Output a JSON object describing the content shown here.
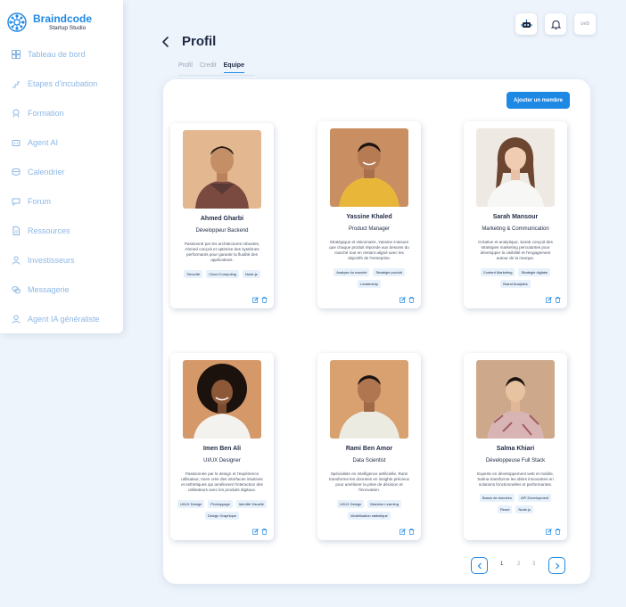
{
  "brand": {
    "name": "Braindcode",
    "subtitle": "Startup Studio"
  },
  "sidebar": {
    "items": [
      {
        "label": "Tableau de bord",
        "icon": "dashboard-icon"
      },
      {
        "label": "Etapes d'incubation",
        "icon": "steps-icon"
      },
      {
        "label": "Formation",
        "icon": "formation-icon"
      },
      {
        "label": "Agent AI",
        "icon": "robot-icon"
      },
      {
        "label": "Calendrier",
        "icon": "calendar-icon"
      },
      {
        "label": "Forum",
        "icon": "forum-icon"
      },
      {
        "label": "Ressources",
        "icon": "document-icon"
      },
      {
        "label": "Investisseurs",
        "icon": "investors-icon"
      },
      {
        "label": "Messagerie",
        "icon": "chat-icon"
      },
      {
        "label": "Agent IA généraliste",
        "icon": "user-ai-icon"
      }
    ]
  },
  "topbar": {
    "third_label": "ueb"
  },
  "header": {
    "title": "Profil"
  },
  "tabs": [
    {
      "label": "Profil",
      "active": false
    },
    {
      "label": "Credit",
      "active": false
    },
    {
      "label": "Equipe",
      "active": true
    }
  ],
  "actions": {
    "add_member": "Ajouter un membre"
  },
  "members": [
    {
      "name": "Ahmed Gharbi",
      "role": "Développeur Backend",
      "bio": "Passionné par les architectures robustes, Ahmed conçoit et optimise des systèmes performants pour garantir la fluidité des applications.",
      "tags": [
        "Sécurité",
        "Cloud Computing",
        "Node.js"
      ]
    },
    {
      "name": "Yassine Khaled",
      "role": "Product Manager",
      "bio": "Stratégique et visionnaire, Yassine s'assure que chaque produit réponde aux besoins du marché tout en restant aligné avec les objectifs de l'entreprise.",
      "tags": [
        "Analyse du marché",
        "Stratégie produit",
        "Leadership"
      ]
    },
    {
      "name": "Sarah Mansour",
      "role": "Marketing & Communication",
      "bio": "Créative et analytique, Sarah conçoit des stratégies marketing percutantes pour développer la visibilité et l'engagement autour de la marque.",
      "tags": [
        "Content Marketing",
        "Stratégie digitale",
        "Brand Analytics"
      ]
    },
    {
      "name": "Imen Ben Ali",
      "role": "UI/UX Designer",
      "bio": "Passionnée par le design et l'expérience utilisateur, Imen crée des interfaces intuitives et esthétiques qui améliorent l'interaction des utilisateurs avec les produits digitaux.",
      "tags": [
        "UI/UX Design",
        "Prototypage",
        "Identité Visuelle",
        "Design Graphique"
      ]
    },
    {
      "name": "Rami Ben Amor",
      "role": "Data Scientist",
      "bio": "Spécialiste en intelligence artificielle, Rami transforme les données en insights précieux pour améliorer la prise de décision et l'innovation.",
      "tags": [
        "UI/UX Design",
        "Machine Learning",
        "Modélisation statistique"
      ]
    },
    {
      "name": "Salma Khiari",
      "role": "Développeuse Full Stack",
      "bio": "Experte en développement web et mobile, Salma transforme les idées innovantes en solutions fonctionnelles et performantes.",
      "tags": [
        "Bases de données",
        "API Development",
        "React",
        "Node.js"
      ]
    }
  ],
  "pagination": {
    "pages": [
      "1",
      "2",
      "3"
    ],
    "current": "1"
  }
}
